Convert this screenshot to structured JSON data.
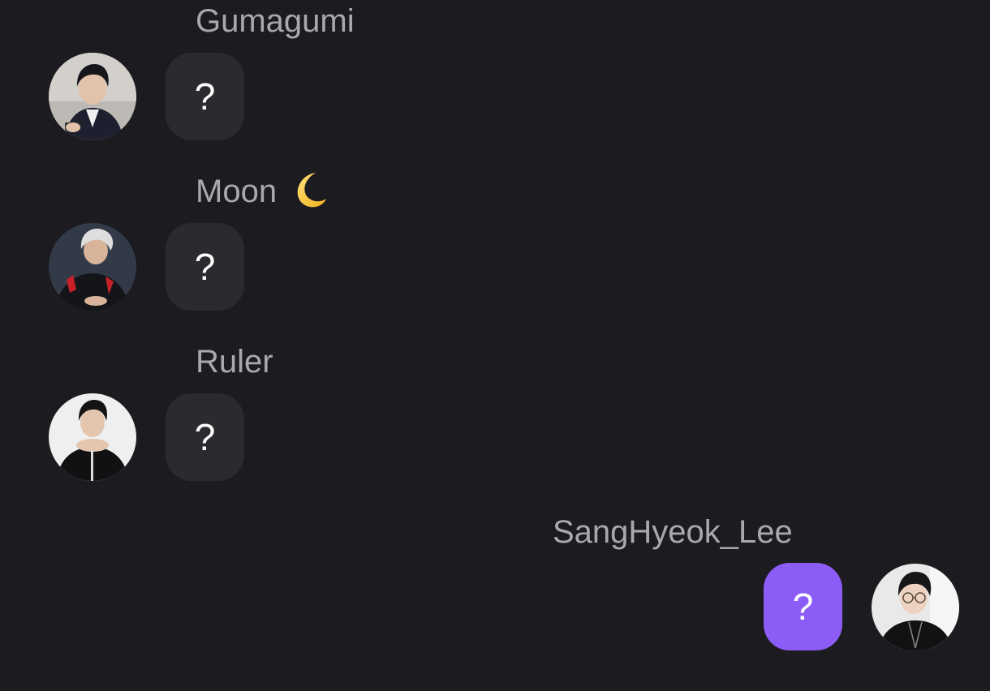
{
  "messages": [
    {
      "sender": "Gumagumi",
      "text": "?",
      "avatar": "profile-photo"
    },
    {
      "sender": "Moon",
      "sender_emoji": "crescent-moon-icon",
      "text": "?",
      "avatar": "profile-photo"
    },
    {
      "sender": "Ruler",
      "text": "?",
      "avatar": "profile-photo"
    },
    {
      "sender": "SangHyeok_Lee",
      "text": "?",
      "avatar": "profile-photo",
      "outgoing": true
    }
  ],
  "colors": {
    "background": "#1c1b1f",
    "incoming_bubble": "#2b2a2e",
    "outgoing_bubble": "#8c5cf6",
    "sender_name": "#a9a8ad",
    "message_text": "#ffffff"
  }
}
